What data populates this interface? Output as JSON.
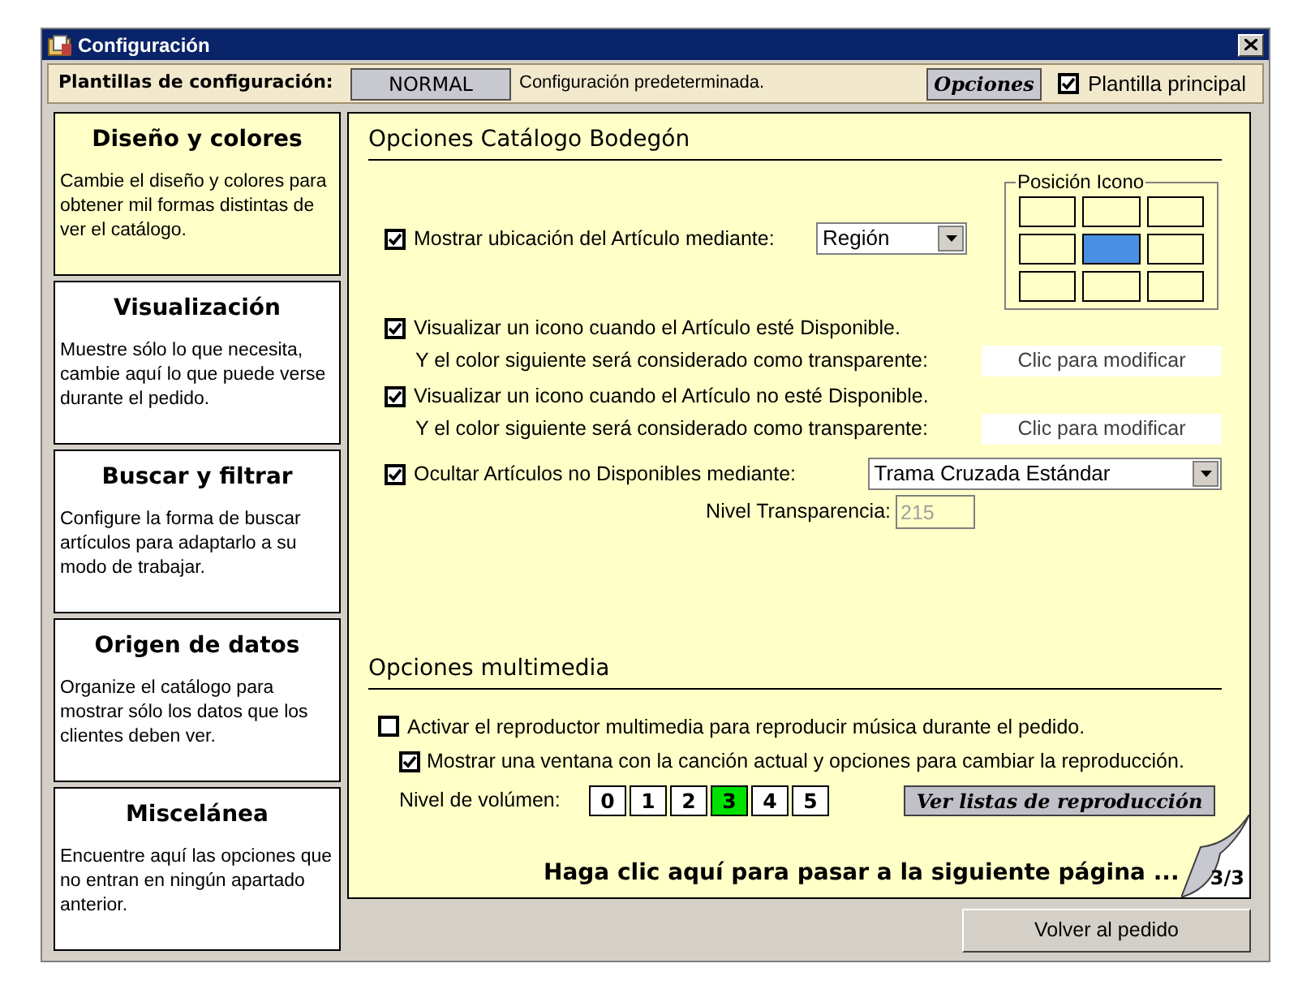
{
  "window": {
    "title": "Configuración"
  },
  "toolbar": {
    "label": "Plantillas de configuración:",
    "template": "NORMAL",
    "description": "Configuración predeterminada.",
    "options_button": "Opciones",
    "main_template": {
      "label": "Plantilla principal",
      "checked": true
    }
  },
  "sidebar": {
    "items": [
      {
        "title": "Diseño y colores",
        "description": "Cambie el diseño y colores para obtener mil formas distintas de ver el catálogo.",
        "selected": true
      },
      {
        "title": "Visualización",
        "description": "Muestre sólo lo que necesita, cambie aquí lo que puede verse durante el pedido.",
        "selected": false
      },
      {
        "title": "Buscar y filtrar",
        "description": "Configure la forma de buscar artículos para adaptarlo a su modo de trabajar.",
        "selected": false
      },
      {
        "title": "Origen de datos",
        "description": "Organize el catálogo para mostrar sólo los datos que los clientes deben ver.",
        "selected": false
      },
      {
        "title": "Miscelánea",
        "description": "Encuentre aquí las opciones que no entran en ningún apartado anterior.",
        "selected": false
      }
    ]
  },
  "catalog": {
    "title": "Opciones Catálogo Bodegón",
    "location": {
      "label": "Mostrar ubicación del Artículo mediante:",
      "checked": true,
      "value": "Región"
    },
    "icon_position": {
      "label": "Posición Icono",
      "cells": [
        {
          "selected": false
        },
        {
          "selected": false
        },
        {
          "selected": false
        },
        {
          "selected": false
        },
        {
          "selected": true
        },
        {
          "selected": false
        },
        {
          "selected": false
        },
        {
          "selected": false
        },
        {
          "selected": false
        }
      ]
    },
    "icons": [
      {
        "label": "Visualizar un icono cuando el Artículo esté Disponible.",
        "checked": true,
        "color_label": "Y el color siguiente será considerado como transparente:",
        "color_button": "Clic para modificar"
      },
      {
        "label": "Visualizar un icono cuando el Artículo no esté Disponible.",
        "checked": true,
        "color_label": "Y el color siguiente será considerado como transparente:",
        "color_button": "Clic para modificar"
      }
    ],
    "hide": {
      "label": "Ocultar Artículos no Disponibles mediante:",
      "checked": true,
      "value": "Trama Cruzada Estándar"
    },
    "transparency": {
      "label": "Nivel Transparencia:",
      "value": "215",
      "disabled": true
    }
  },
  "multimedia": {
    "title": "Opciones multimedia",
    "player": {
      "label": "Activar el reproductor multimedia para reproducir música durante el pedido.",
      "checked": false
    },
    "window": {
      "label": "Mostrar una ventana con la canción actual y opciones para cambiar la reproducción.",
      "checked": true
    },
    "volume": {
      "label": "Nivel de volúmen:",
      "levels": [
        {
          "label": "0",
          "selected": false
        },
        {
          "label": "1",
          "selected": false
        },
        {
          "label": "2",
          "selected": false
        },
        {
          "label": "3",
          "selected": true
        },
        {
          "label": "4",
          "selected": false
        },
        {
          "label": "5",
          "selected": false
        }
      ]
    },
    "playlists_button": "Ver listas de reproducción"
  },
  "next_page": {
    "text": "Haga clic aquí para pasar a la siguiente página ...",
    "page": "3/3"
  },
  "footer": {
    "button": "Volver al pedido"
  }
}
